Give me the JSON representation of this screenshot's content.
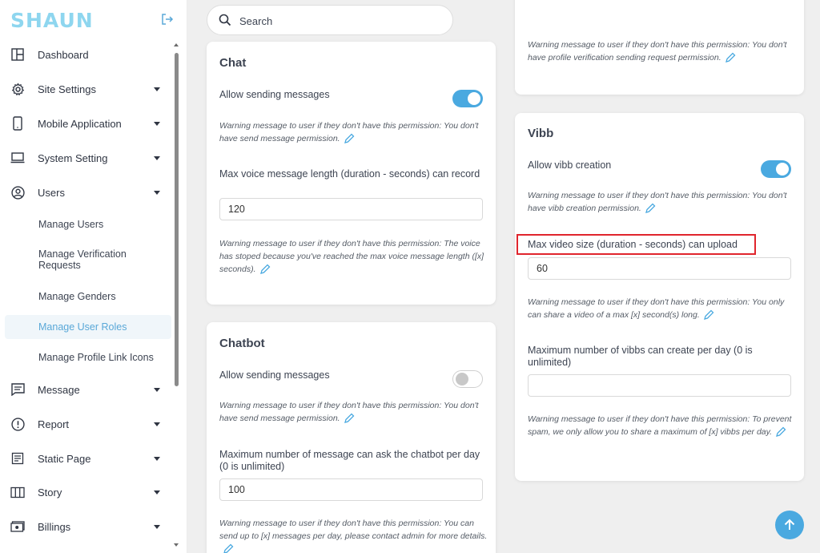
{
  "app": {
    "logo_text": "SHAUN"
  },
  "search": {
    "placeholder": "Search"
  },
  "sidebar": {
    "items": [
      {
        "label": "Dashboard",
        "icon": "dashboard-icon",
        "has_caret": false
      },
      {
        "label": "Site Settings",
        "icon": "gear-icon",
        "has_caret": true
      },
      {
        "label": "Mobile Application",
        "icon": "mobile-icon",
        "has_caret": true
      },
      {
        "label": "System Setting",
        "icon": "laptop-icon",
        "has_caret": true
      },
      {
        "label": "Users",
        "icon": "user-circle-icon",
        "has_caret": true
      },
      {
        "label": "Message",
        "icon": "message-icon",
        "has_caret": true
      },
      {
        "label": "Report",
        "icon": "alert-icon",
        "has_caret": true
      },
      {
        "label": "Static Page",
        "icon": "document-icon",
        "has_caret": true
      },
      {
        "label": "Story",
        "icon": "columns-icon",
        "has_caret": true
      },
      {
        "label": "Billings",
        "icon": "billing-icon",
        "has_caret": true
      }
    ],
    "users_sub": [
      {
        "label": "Manage Users"
      },
      {
        "label": "Manage Verification Requests"
      },
      {
        "label": "Manage Genders"
      },
      {
        "label": "Manage User Roles",
        "active": true
      },
      {
        "label": "Manage Profile Link Icons"
      }
    ]
  },
  "chat": {
    "title": "Chat",
    "allow_label": "Allow sending messages",
    "allow_on": true,
    "warn1": "Warning message to user if they don't have this permission: You don't have send message permission.",
    "max_voice_label": "Max voice message length (duration - seconds) can record",
    "max_voice_value": "120",
    "warn2": "Warning message to user if they don't have this permission: The voice has stoped because you've reached the max voice message length ([x] seconds)."
  },
  "chatbot": {
    "title": "Chatbot",
    "allow_label": "Allow sending messages",
    "allow_on": false,
    "warn1": "Warning message to user if they don't have this permission: You don't have send message permission.",
    "max_label": "Maximum number of message can ask the chatbot per day (0 is unlimited)",
    "max_value": "100",
    "warn2": "Warning message to user if they don't have this permission: You can send up to [x] messages per day, please contact admin for more details."
  },
  "profile_verify": {
    "warn": "Warning message to user if they don't have this permission: You don't have profile verification sending request permission."
  },
  "vibb": {
    "title": "Vibb",
    "allow_label": "Allow vibb creation",
    "allow_on": true,
    "warn1": "Warning message to user if they don't have this permission: You don't have vibb creation permission.",
    "max_video_label": "Max video size (duration - seconds) can upload",
    "max_video_value": "60",
    "warn2": "Warning message to user if they don't have this permission: You only can share a video of a max [x] second(s) long.",
    "max_per_day_label": "Maximum number of vibbs can create per day (0 is unlimited)",
    "max_per_day_value": "",
    "warn3": "Warning message to user if they don't have this permission: To prevent spam, we only allow you to share a maximum of [x] vibbs per day."
  },
  "colors": {
    "accent": "#4aa9e0",
    "logo": "#8ed6ef",
    "highlight": "#e0252d"
  }
}
